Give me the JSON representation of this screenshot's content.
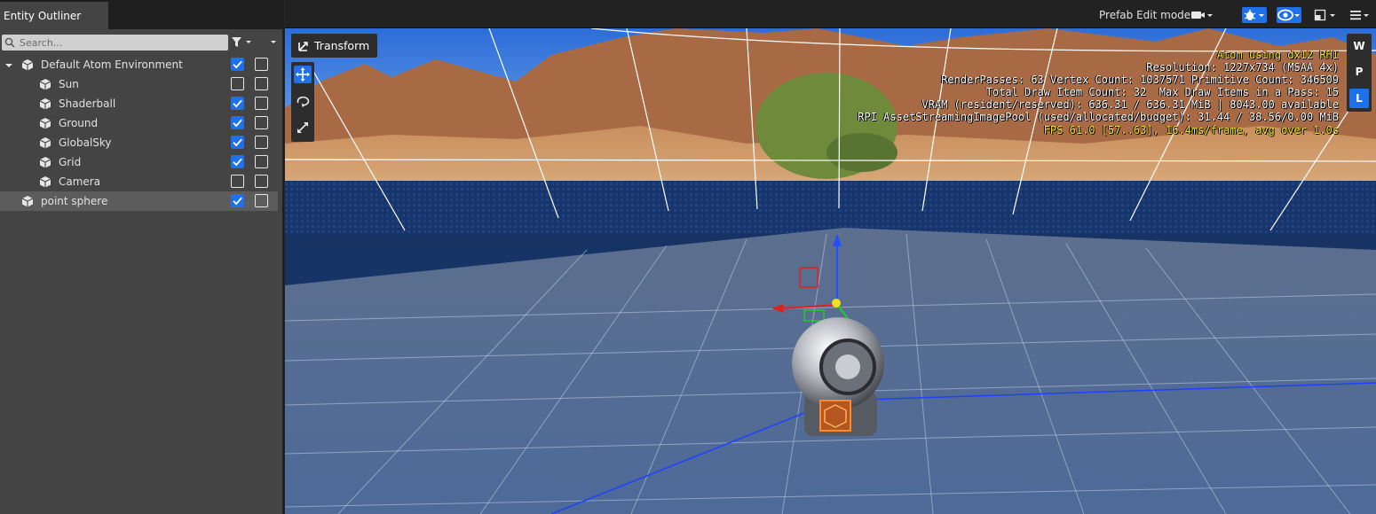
{
  "outliner": {
    "title": "Entity Outliner",
    "search_placeholder": "Search...",
    "entities": [
      {
        "name": "Default Atom Environment",
        "expander": "expanded",
        "visible": true,
        "locked": false,
        "selected": false
      },
      {
        "name": "Sun",
        "visible": false,
        "locked": false,
        "selected": false
      },
      {
        "name": "Shaderball",
        "visible": true,
        "locked": false,
        "selected": false
      },
      {
        "name": "Ground",
        "visible": true,
        "locked": false,
        "selected": false
      },
      {
        "name": "GlobalSky",
        "visible": true,
        "locked": false,
        "selected": false
      },
      {
        "name": "Grid",
        "visible": true,
        "locked": false,
        "selected": false
      },
      {
        "name": "Camera",
        "visible": false,
        "locked": false,
        "selected": false
      },
      {
        "name": "point sphere",
        "visible": true,
        "locked": false,
        "selected": true
      }
    ]
  },
  "viewport": {
    "mode_label": "Prefab Edit mode",
    "transform_label": "Transform",
    "coordinate_modes": [
      "W",
      "P",
      "L"
    ],
    "active_coordinate_mode": "L",
    "stats": [
      {
        "text": "Atom using dx12 RHI",
        "color": "yellow"
      },
      {
        "text": "Resolution: 1227x734 (MSAA 4x)",
        "color": "white"
      },
      {
        "text": "RenderPasses: 63 Vertex Count: 1037571 Primitive Count: 346509",
        "color": "white"
      },
      {
        "text": "Total Draw Item Count: 32  Max Draw Items in a Pass: 15",
        "color": "white"
      },
      {
        "text": "VRAM (resident/reserved): 636.31 / 636.31 MiB | 8043.00 available",
        "color": "white"
      },
      {
        "text": "RPI AssetStreamingImagePool (used/allocated/budget): 31.44 / 38.56/0.00 MiB",
        "color": "white"
      },
      {
        "text": "FPS 61.0 [57..63], 16.4ms/frame, avg over 1.0s",
        "color": "yellow"
      }
    ]
  },
  "colors": {
    "accent": "#1e70eb",
    "panel_bg": "#444444",
    "toolbar_bg": "#222222",
    "stats_yellow": "#f3e82a"
  },
  "icons": {
    "entity": "cube-icon",
    "search": "search-icon",
    "filter": "filter-icon",
    "camera": "camera-icon",
    "debug": "bug-icon",
    "visibility": "eye-icon",
    "layout": "layout-icon",
    "menu": "hamburger-icon",
    "transform": "transform-icon",
    "move": "move-icon",
    "rotate": "rotate-icon",
    "scale": "scale-icon"
  }
}
